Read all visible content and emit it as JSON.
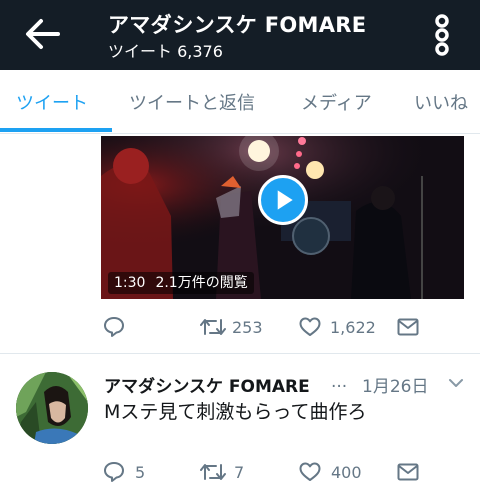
{
  "header": {
    "title": "アマダシンスケ FOMARE",
    "subtitle": "ツイート 6,376"
  },
  "tabs": [
    {
      "label": "ツイート",
      "active": true
    },
    {
      "label": "ツイートと返信",
      "active": false
    },
    {
      "label": "メディア",
      "active": false
    },
    {
      "label": "いいね",
      "active": false
    }
  ],
  "video": {
    "duration": "1:30",
    "views": "2.1万件の閲覧"
  },
  "tweet1": {
    "reply_count": "",
    "retweet_count": "253",
    "like_count": "1,622"
  },
  "tweet2": {
    "name": "アマダシンスケ FOMARE",
    "ellipsis": "...",
    "date": "1月26日",
    "text": "Mステ見て刺激もらって曲作ろ",
    "reply_count": "5",
    "retweet_count": "7",
    "like_count": "400"
  },
  "colors": {
    "header_bg": "#141d26",
    "accent": "#1da1f2",
    "muted": "#657786"
  }
}
